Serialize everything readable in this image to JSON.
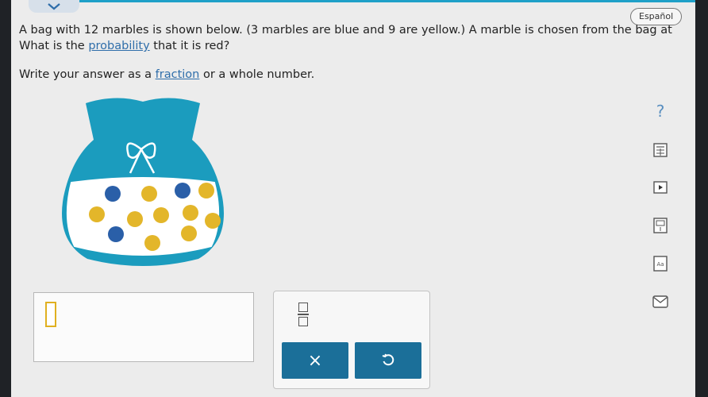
{
  "header": {
    "language_button": "Español"
  },
  "question": {
    "line1_part1": "A bag with 12 marbles is shown below. (3 marbles are blue and 9 are yellow.) A marble is chosen from the bag at",
    "line2_part1": "What is the ",
    "line2_link": "probability",
    "line2_part2": " that it is red?",
    "instr_part1": "Write your answer as a ",
    "instr_link": "fraction",
    "instr_part2": " or a whole number."
  },
  "colors": {
    "bag": "#1b9cbe",
    "marble_blue": "#2a5fa8",
    "marble_yellow": "#e3b62a",
    "button": "#1b6f99"
  },
  "marbles": {
    "blue_count": 3,
    "yellow_count": 9,
    "total": 12
  },
  "answer": {
    "value": ""
  },
  "tools": {
    "clear_label": "×",
    "help_label": "?"
  },
  "icons": [
    "chevron-down-icon",
    "fraction-icon",
    "undo-icon",
    "help-icon",
    "calculator-icon",
    "video-icon",
    "textbook-icon",
    "glossary-icon",
    "email-icon"
  ]
}
